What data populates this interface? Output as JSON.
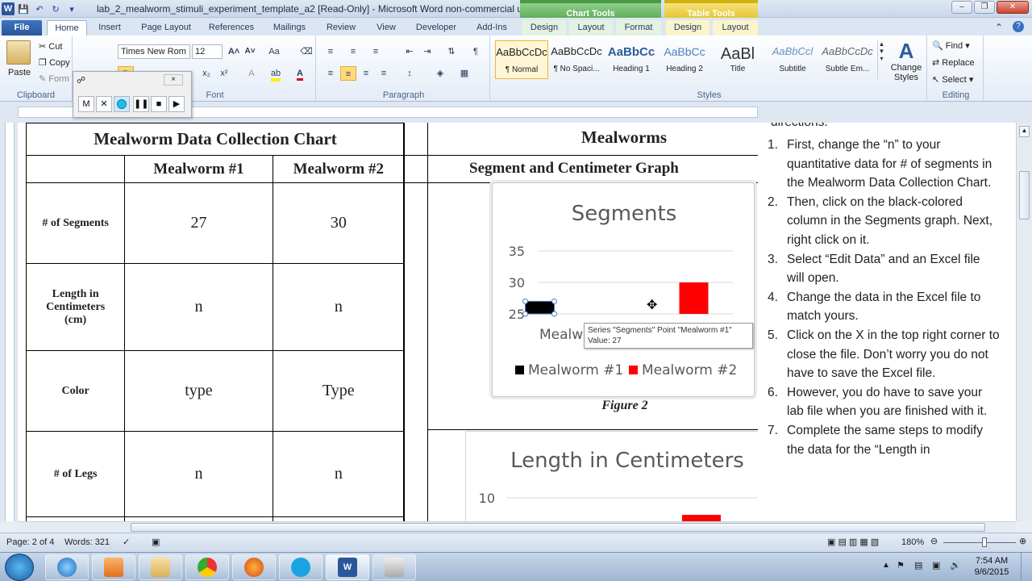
{
  "titlebar": {
    "title": "lab_2_mealworm_stimuli_experiment_template_a2 [Read-Only] - Microsoft Word non-commercial use",
    "context_chart": "Chart Tools",
    "context_table": "Table Tools"
  },
  "tabs": [
    "File",
    "Home",
    "Insert",
    "Page Layout",
    "References",
    "Mailings",
    "Review",
    "View",
    "Developer",
    "Add-Ins",
    "Design",
    "Layout",
    "Format",
    "Design",
    "Layout"
  ],
  "ribbon": {
    "clipboard": {
      "paste": "Paste",
      "cut": "Cut",
      "copy": "Copy",
      "format": "Form",
      "label": "Clipboard"
    },
    "font": {
      "name": "Times New Rom",
      "size": "12",
      "label": "Font"
    },
    "paragraph": {
      "label": "Paragraph"
    },
    "styles": {
      "label": "Styles",
      "items": [
        {
          "preview": "AaBbCcDc",
          "name": "¶ Normal"
        },
        {
          "preview": "AaBbCcDc",
          "name": "¶ No Spaci..."
        },
        {
          "preview": "AaBbCc",
          "name": "Heading 1"
        },
        {
          "preview": "AaBbCc",
          "name": "Heading 2"
        },
        {
          "preview": "AaBl",
          "name": "Title"
        },
        {
          "preview": "AaBbCcl",
          "name": "Subtitle"
        },
        {
          "preview": "AaBbCcDc",
          "name": "Subtle Em..."
        }
      ],
      "change": "Change Styles"
    },
    "editing": {
      "find": "Find",
      "replace": "Replace",
      "select": "Select",
      "label": "Editing"
    }
  },
  "table": {
    "title": "Mealworm Data Collection Chart",
    "col1": "Mealworm #1",
    "col2": "Mealworm #2",
    "rows": [
      {
        "label": "# of Segments",
        "v1": "27",
        "v2": "30"
      },
      {
        "label": "Length in Centimeters (cm)",
        "v1": "n",
        "v2": "n"
      },
      {
        "label": "Color",
        "v1": "type",
        "v2": "Type"
      },
      {
        "label": "# of Legs",
        "v1": "n",
        "v2": "n"
      }
    ]
  },
  "right_table": {
    "title": "Mealworms",
    "subtitle": "Segment and Centimeter Graph"
  },
  "chart_data": [
    {
      "type": "bar",
      "title": "Segments",
      "categories": [
        "Mealworm #1",
        "Mealworm #2"
      ],
      "series": [
        {
          "name": "Mealworm #1",
          "color": "#000000",
          "values": [
            27,
            null
          ]
        },
        {
          "name": "Mealworm #2",
          "color": "#ff0000",
          "values": [
            null,
            30
          ]
        }
      ],
      "yticks": [
        25,
        30,
        35
      ],
      "ylim": [
        25,
        35
      ],
      "category_label_visible": "Mealw",
      "legend": "bottom",
      "tooltip": {
        "line1": "Series \"Segments\" Point \"Mealworm #1\"",
        "line2": "Value: 27"
      },
      "caption": "Figure 2"
    },
    {
      "type": "bar",
      "title": "Length in Centimeters",
      "yticks": [
        10
      ],
      "bar_color": "#ff0000"
    }
  ],
  "directions": {
    "lead": "directions.",
    "items": [
      {
        "n": "1.",
        "text": "First, change the “n” to your quantitative data for # of segments in the Mealworm Data Collection Chart."
      },
      {
        "n": "2.",
        "text": "Then, click on the black-colored column in the Segments graph. Next, right click on it."
      },
      {
        "n": "3.",
        "text": "Select “Edit Data” and an Excel file will open."
      },
      {
        "n": "4.",
        "text": "Change the data in the Excel file to match yours."
      },
      {
        "n": "5.",
        "text": "Click on the X in the top right corner to close the file. Don’t worry you do not have to save the Excel file."
      },
      {
        "n": "6.",
        "text": "However, you do have to save your lab file when you are finished with it."
      },
      {
        "n": "7.",
        "text": "Complete the same steps to modify the data for the “Length in"
      }
    ]
  },
  "status": {
    "page": "Page: 2 of 4",
    "words": "Words: 321",
    "zoom": "180%"
  },
  "clock": {
    "time": "7:54 AM",
    "date": "9/6/2015"
  },
  "recorder": {
    "m": "M",
    "x": "×"
  }
}
